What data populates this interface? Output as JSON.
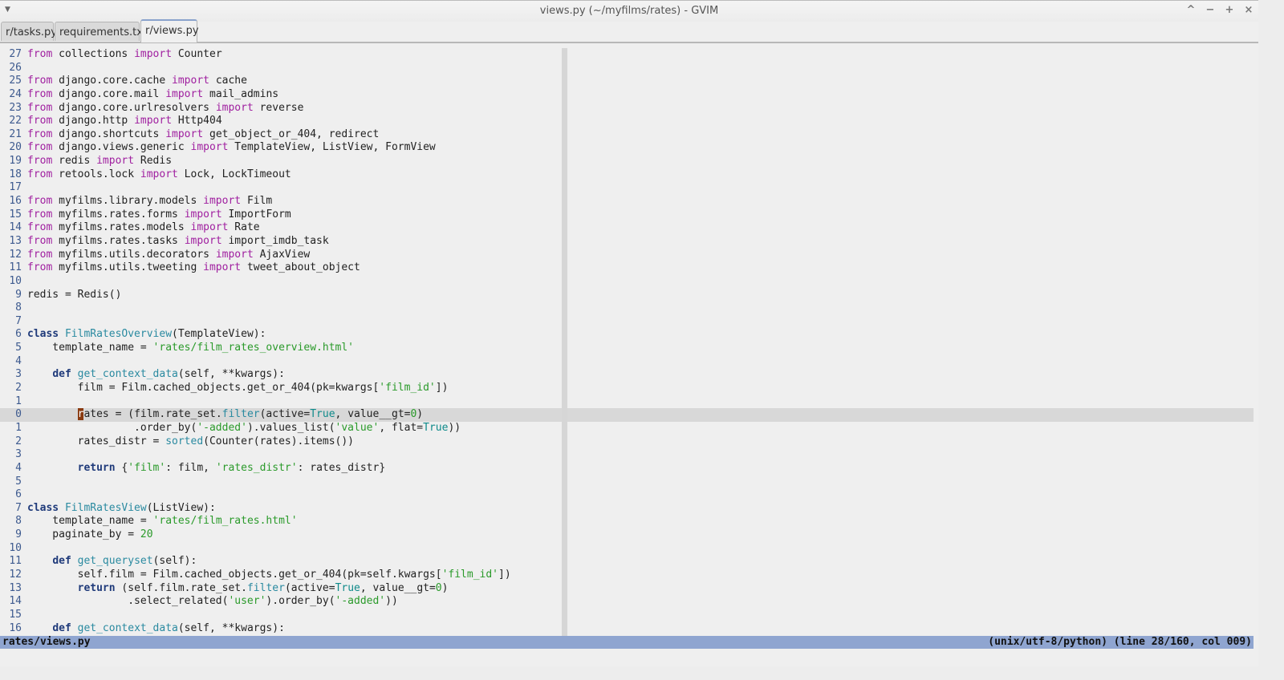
{
  "window": {
    "title": "views.py (~/myfilms/rates) - GVIM",
    "buttons": [
      "^",
      "−",
      "+",
      "×"
    ]
  },
  "tabs": [
    {
      "label": "r/tasks.py",
      "active": false
    },
    {
      "label": "requirements.txt",
      "active": false
    },
    {
      "label": "r/views.py",
      "active": true
    }
  ],
  "editor": {
    "cursor_line_index": 27,
    "lines": [
      {
        "n": "27",
        "t": [
          [
            "kw",
            "from"
          ],
          [
            "p",
            " collections "
          ],
          [
            "kw",
            "import"
          ],
          [
            "p",
            " Counter"
          ]
        ]
      },
      {
        "n": "26",
        "t": []
      },
      {
        "n": "25",
        "t": [
          [
            "kw",
            "from"
          ],
          [
            "p",
            " django.core.cache "
          ],
          [
            "kw",
            "import"
          ],
          [
            "p",
            " cache"
          ]
        ]
      },
      {
        "n": "24",
        "t": [
          [
            "kw",
            "from"
          ],
          [
            "p",
            " django.core.mail "
          ],
          [
            "kw",
            "import"
          ],
          [
            "p",
            " mail_admins"
          ]
        ]
      },
      {
        "n": "23",
        "t": [
          [
            "kw",
            "from"
          ],
          [
            "p",
            " django.core.urlresolvers "
          ],
          [
            "kw",
            "import"
          ],
          [
            "p",
            " reverse"
          ]
        ]
      },
      {
        "n": "22",
        "t": [
          [
            "kw",
            "from"
          ],
          [
            "p",
            " django.http "
          ],
          [
            "kw",
            "import"
          ],
          [
            "p",
            " Http404"
          ]
        ]
      },
      {
        "n": "21",
        "t": [
          [
            "kw",
            "from"
          ],
          [
            "p",
            " django.shortcuts "
          ],
          [
            "kw",
            "import"
          ],
          [
            "p",
            " get_object_or_404, redirect"
          ]
        ]
      },
      {
        "n": "20",
        "t": [
          [
            "kw",
            "from"
          ],
          [
            "p",
            " django.views.generic "
          ],
          [
            "kw",
            "import"
          ],
          [
            "p",
            " TemplateView, ListView, FormView"
          ]
        ]
      },
      {
        "n": "19",
        "t": [
          [
            "kw",
            "from"
          ],
          [
            "p",
            " redis "
          ],
          [
            "kw",
            "import"
          ],
          [
            "p",
            " Redis"
          ]
        ]
      },
      {
        "n": "18",
        "t": [
          [
            "kw",
            "from"
          ],
          [
            "p",
            " retools.lock "
          ],
          [
            "kw",
            "import"
          ],
          [
            "p",
            " Lock, LockTimeout"
          ]
        ]
      },
      {
        "n": "17",
        "t": []
      },
      {
        "n": "16",
        "t": [
          [
            "kw",
            "from"
          ],
          [
            "p",
            " myfilms.library.models "
          ],
          [
            "kw",
            "import"
          ],
          [
            "p",
            " Film"
          ]
        ]
      },
      {
        "n": "15",
        "t": [
          [
            "kw",
            "from"
          ],
          [
            "p",
            " myfilms.rates.forms "
          ],
          [
            "kw",
            "import"
          ],
          [
            "p",
            " ImportForm"
          ]
        ]
      },
      {
        "n": "14",
        "t": [
          [
            "kw",
            "from"
          ],
          [
            "p",
            " myfilms.rates.models "
          ],
          [
            "kw",
            "import"
          ],
          [
            "p",
            " Rate"
          ]
        ]
      },
      {
        "n": "13",
        "t": [
          [
            "kw",
            "from"
          ],
          [
            "p",
            " myfilms.rates.tasks "
          ],
          [
            "kw",
            "import"
          ],
          [
            "p",
            " import_imdb_task"
          ]
        ]
      },
      {
        "n": "12",
        "t": [
          [
            "kw",
            "from"
          ],
          [
            "p",
            " myfilms.utils.decorators "
          ],
          [
            "kw",
            "import"
          ],
          [
            "p",
            " AjaxView"
          ]
        ]
      },
      {
        "n": "11",
        "t": [
          [
            "kw",
            "from"
          ],
          [
            "p",
            " myfilms.utils.tweeting "
          ],
          [
            "kw",
            "import"
          ],
          [
            "p",
            " tweet_about_object"
          ]
        ]
      },
      {
        "n": "10",
        "t": []
      },
      {
        "n": "9",
        "t": [
          [
            "p",
            "redis = Redis()"
          ]
        ]
      },
      {
        "n": "8",
        "t": []
      },
      {
        "n": "7",
        "t": []
      },
      {
        "n": "6",
        "t": [
          [
            "st",
            "class"
          ],
          [
            "p",
            " "
          ],
          [
            "fn",
            "FilmRatesOverview"
          ],
          [
            "p",
            "(TemplateView):"
          ]
        ]
      },
      {
        "n": "5",
        "t": [
          [
            "p",
            "    template_name = "
          ],
          [
            "s",
            "'rates/film_rates_overview.html'"
          ]
        ]
      },
      {
        "n": "4",
        "t": []
      },
      {
        "n": "3",
        "t": [
          [
            "p",
            "    "
          ],
          [
            "st",
            "def"
          ],
          [
            "p",
            " "
          ],
          [
            "fn",
            "get_context_data"
          ],
          [
            "p",
            "(self, **kwargs):"
          ]
        ]
      },
      {
        "n": "2",
        "t": [
          [
            "p",
            "        film = Film.cached_objects.get_or_404(pk=kwargs["
          ],
          [
            "s",
            "'film_id'"
          ],
          [
            "p",
            "])"
          ]
        ]
      },
      {
        "n": "1",
        "t": []
      },
      {
        "n": "0",
        "t": [
          [
            "p",
            "        "
          ],
          [
            "cur",
            "r"
          ],
          [
            "p",
            "ates = (film.rate_set."
          ],
          [
            "fn",
            "filter"
          ],
          [
            "p",
            "(active="
          ],
          [
            "c",
            "True"
          ],
          [
            "p",
            ", value__gt="
          ],
          [
            "num",
            "0"
          ],
          [
            "p",
            ")"
          ]
        ]
      },
      {
        "n": "1",
        "t": [
          [
            "p",
            "                 .order_by("
          ],
          [
            "s",
            "'-added'"
          ],
          [
            "p",
            ").values_list("
          ],
          [
            "s",
            "'value'"
          ],
          [
            "p",
            ", flat="
          ],
          [
            "c",
            "True"
          ],
          [
            "p",
            "))"
          ]
        ]
      },
      {
        "n": "2",
        "t": [
          [
            "p",
            "        rates_distr = "
          ],
          [
            "fn",
            "sorted"
          ],
          [
            "p",
            "(Counter(rates).items())"
          ]
        ]
      },
      {
        "n": "3",
        "t": []
      },
      {
        "n": "4",
        "t": [
          [
            "p",
            "        "
          ],
          [
            "st",
            "return"
          ],
          [
            "p",
            " {"
          ],
          [
            "s",
            "'film'"
          ],
          [
            "p",
            ": film, "
          ],
          [
            "s",
            "'rates_distr'"
          ],
          [
            "p",
            ": rates_distr}"
          ]
        ]
      },
      {
        "n": "5",
        "t": []
      },
      {
        "n": "6",
        "t": []
      },
      {
        "n": "7",
        "t": [
          [
            "st",
            "class"
          ],
          [
            "p",
            " "
          ],
          [
            "fn",
            "FilmRatesView"
          ],
          [
            "p",
            "(ListView):"
          ]
        ]
      },
      {
        "n": "8",
        "t": [
          [
            "p",
            "    template_name = "
          ],
          [
            "s",
            "'rates/film_rates.html'"
          ]
        ]
      },
      {
        "n": "9",
        "t": [
          [
            "p",
            "    paginate_by = "
          ],
          [
            "num",
            "20"
          ]
        ]
      },
      {
        "n": "10",
        "t": []
      },
      {
        "n": "11",
        "t": [
          [
            "p",
            "    "
          ],
          [
            "st",
            "def"
          ],
          [
            "p",
            " "
          ],
          [
            "fn",
            "get_queryset"
          ],
          [
            "p",
            "(self):"
          ]
        ]
      },
      {
        "n": "12",
        "t": [
          [
            "p",
            "        self.film = Film.cached_objects.get_or_404(pk=self.kwargs["
          ],
          [
            "s",
            "'film_id'"
          ],
          [
            "p",
            "])"
          ]
        ]
      },
      {
        "n": "13",
        "t": [
          [
            "p",
            "        "
          ],
          [
            "st",
            "return"
          ],
          [
            "p",
            " (self.film.rate_set."
          ],
          [
            "fn",
            "filter"
          ],
          [
            "p",
            "(active="
          ],
          [
            "c",
            "True"
          ],
          [
            "p",
            ", value__gt="
          ],
          [
            "num",
            "0"
          ],
          [
            "p",
            ")"
          ]
        ]
      },
      {
        "n": "14",
        "t": [
          [
            "p",
            "                .select_related("
          ],
          [
            "s",
            "'user'"
          ],
          [
            "p",
            ").order_by("
          ],
          [
            "s",
            "'-added'"
          ],
          [
            "p",
            "))"
          ]
        ]
      },
      {
        "n": "15",
        "t": []
      },
      {
        "n": "16",
        "t": [
          [
            "p",
            "    "
          ],
          [
            "st",
            "def"
          ],
          [
            "p",
            " "
          ],
          [
            "fn",
            "get_context_data"
          ],
          [
            "p",
            "(self, **kwargs):"
          ]
        ]
      }
    ]
  },
  "status": {
    "filename": "rates/views.py",
    "info": "(unix/utf-8/python) (line 28/160, col 009)"
  }
}
